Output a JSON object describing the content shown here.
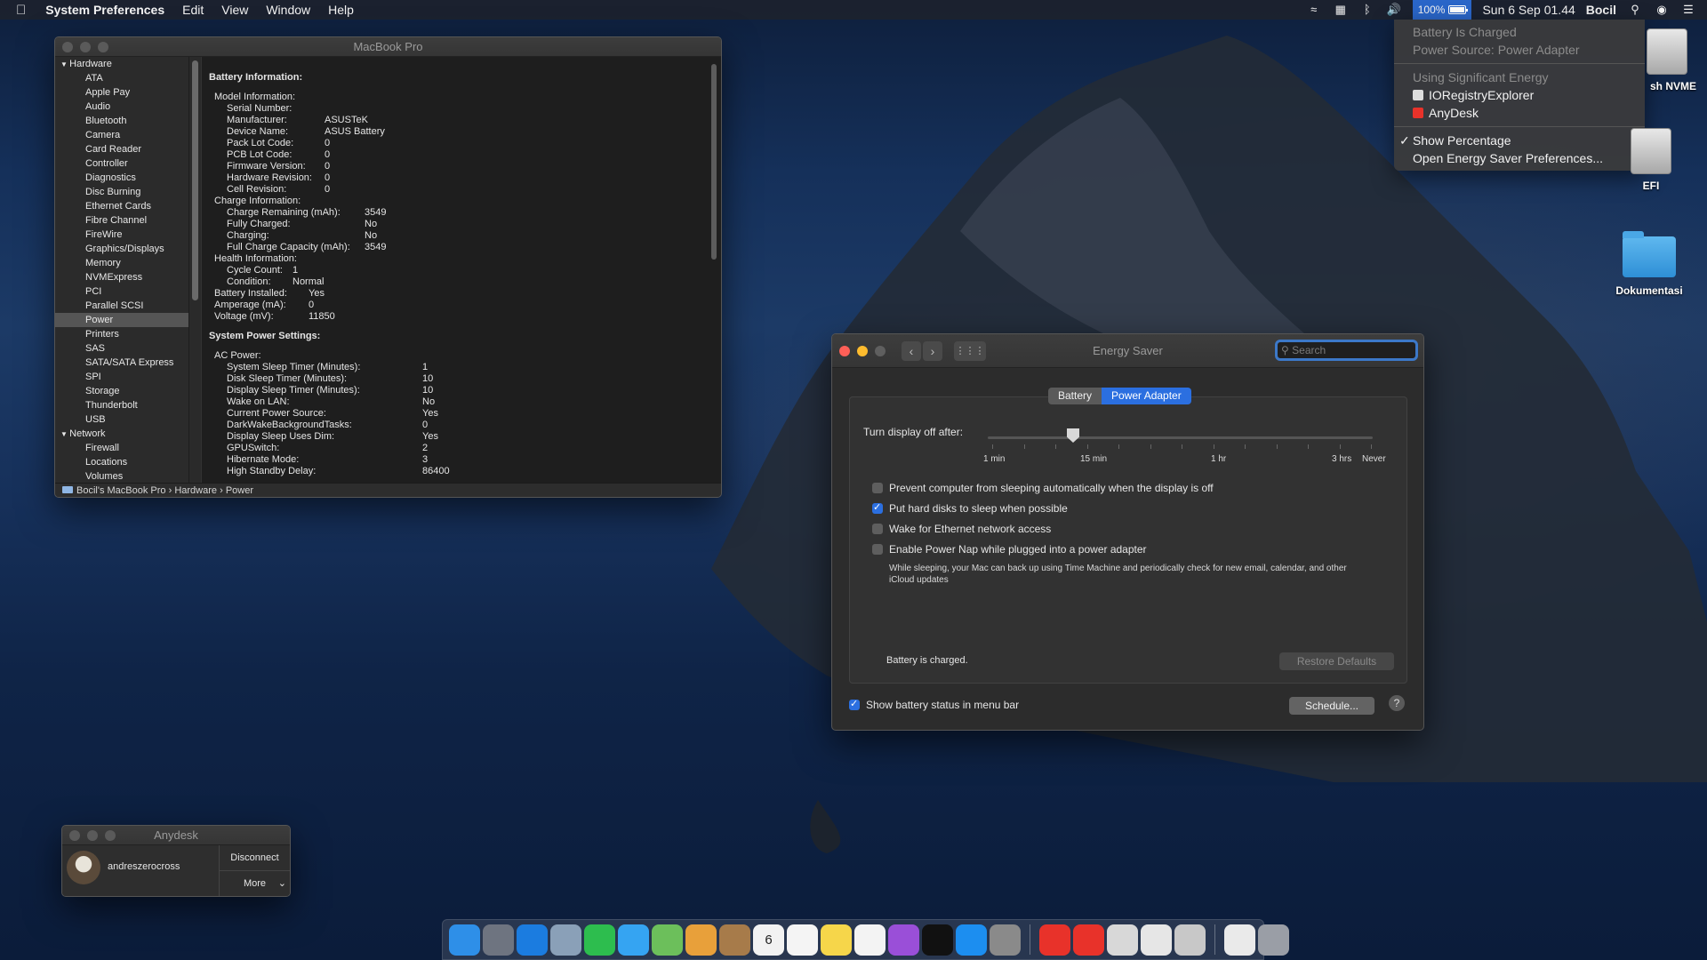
{
  "menubar": {
    "app_name": "System Preferences",
    "menus": [
      "Edit",
      "View",
      "Window",
      "Help"
    ],
    "battery_percent": "100%",
    "battery_level": 1.0,
    "datetime": "Sun 6 Sep  01.44",
    "user": "Bocil"
  },
  "battery_menu": {
    "status": "Battery Is Charged",
    "power_source": "Power Source: Power Adapter",
    "heading_energy": "Using Significant Energy",
    "apps": [
      "IORegistryExplorer",
      "AnyDesk"
    ],
    "show_percentage": "Show Percentage",
    "open_prefs": "Open Energy Saver Preferences..."
  },
  "desktop": {
    "icons": [
      "sh NVME",
      "EFI",
      "Dokumentasi"
    ]
  },
  "sysinfo": {
    "title": "MacBook Pro",
    "sidebar": [
      {
        "label": "Hardware",
        "group": true
      },
      {
        "label": "ATA"
      },
      {
        "label": "Apple Pay"
      },
      {
        "label": "Audio"
      },
      {
        "label": "Bluetooth"
      },
      {
        "label": "Camera"
      },
      {
        "label": "Card Reader"
      },
      {
        "label": "Controller"
      },
      {
        "label": "Diagnostics"
      },
      {
        "label": "Disc Burning"
      },
      {
        "label": "Ethernet Cards"
      },
      {
        "label": "Fibre Channel"
      },
      {
        "label": "FireWire"
      },
      {
        "label": "Graphics/Displays"
      },
      {
        "label": "Memory"
      },
      {
        "label": "NVMExpress"
      },
      {
        "label": "PCI"
      },
      {
        "label": "Parallel SCSI"
      },
      {
        "label": "Power",
        "selected": true
      },
      {
        "label": "Printers"
      },
      {
        "label": "SAS"
      },
      {
        "label": "SATA/SATA Express"
      },
      {
        "label": "SPI"
      },
      {
        "label": "Storage"
      },
      {
        "label": "Thunderbolt"
      },
      {
        "label": "USB"
      },
      {
        "label": "Network",
        "group": true
      },
      {
        "label": "Firewall"
      },
      {
        "label": "Locations"
      },
      {
        "label": "Volumes"
      }
    ],
    "content": [
      {
        "t": "Battery Information:",
        "h": true,
        "i": 0,
        "gap": 1
      },
      {
        "t": "Model Information:",
        "i": 1,
        "gap": 1
      },
      {
        "t": "Serial Number:",
        "v": "",
        "i": 2
      },
      {
        "t": "Manufacturer:",
        "v": "ASUSTeK",
        "i": 2
      },
      {
        "t": "Device Name:",
        "v": "ASUS Battery",
        "i": 2
      },
      {
        "t": "Pack Lot Code:",
        "v": "0",
        "i": 2
      },
      {
        "t": "PCB Lot Code:",
        "v": "0",
        "i": 2
      },
      {
        "t": "Firmware Version:",
        "v": "0",
        "i": 2
      },
      {
        "t": "Hardware Revision:",
        "v": "0",
        "i": 2
      },
      {
        "t": "Cell Revision:",
        "v": "0",
        "i": 2
      },
      {
        "t": "Charge Information:",
        "i": 1
      },
      {
        "t": "Charge Remaining (mAh):",
        "v": "3549",
        "i": 2,
        "vc": 2
      },
      {
        "t": "Fully Charged:",
        "v": "No",
        "i": 2,
        "vc": 2
      },
      {
        "t": "Charging:",
        "v": "No",
        "i": 2,
        "vc": 2
      },
      {
        "t": "Full Charge Capacity (mAh):",
        "v": "3549",
        "i": 2,
        "vc": 2
      },
      {
        "t": "Health Information:",
        "i": 1
      },
      {
        "t": "Cycle Count:",
        "v": "1",
        "i": 2,
        "vc": 3
      },
      {
        "t": "Condition:",
        "v": "Normal",
        "i": 2,
        "vc": 4
      },
      {
        "t": "Battery Installed:",
        "v": "Yes",
        "i": 1,
        "vc": 5
      },
      {
        "t": "Amperage (mA):",
        "v": "0",
        "i": 1,
        "vc": 5
      },
      {
        "t": "Voltage (mV):",
        "v": "11850",
        "i": 1,
        "vc": 5
      },
      {
        "t": "System Power Settings:",
        "h": true,
        "i": 0,
        "gap": 1
      },
      {
        "t": "AC Power:",
        "i": 1,
        "gap": 1
      },
      {
        "t": "System Sleep Timer (Minutes):",
        "v": "1",
        "i": 2,
        "vc": 6
      },
      {
        "t": "Disk Sleep Timer (Minutes):",
        "v": "10",
        "i": 2,
        "vc": 6
      },
      {
        "t": "Display Sleep Timer (Minutes):",
        "v": "10",
        "i": 2,
        "vc": 6
      },
      {
        "t": "Wake on LAN:",
        "v": "No",
        "i": 2,
        "vc": 6
      },
      {
        "t": "Current Power Source:",
        "v": "Yes",
        "i": 2,
        "vc": 6
      },
      {
        "t": "DarkWakeBackgroundTasks:",
        "v": "0",
        "i": 2,
        "vc": 6
      },
      {
        "t": "Display Sleep Uses Dim:",
        "v": "Yes",
        "i": 2,
        "vc": 6
      },
      {
        "t": "GPUSwitch:",
        "v": "2",
        "i": 2,
        "vc": 6
      },
      {
        "t": "Hibernate Mode:",
        "v": "3",
        "i": 2,
        "vc": 6
      },
      {
        "t": "High Standby Delay:",
        "v": "86400",
        "i": 2,
        "vc": 6
      }
    ],
    "path": [
      "Bocil's MacBook Pro",
      "Hardware",
      "Power"
    ]
  },
  "energy": {
    "title": "Energy Saver",
    "search_placeholder": "Search",
    "tabs": [
      "Battery",
      "Power Adapter"
    ],
    "active_tab": "Power Adapter",
    "slider_label": "Turn display off after:",
    "slider_value": "10 min",
    "tick_labels": [
      "1 min",
      "15 min",
      "1 hr",
      "3 hrs",
      "Never"
    ],
    "options": [
      {
        "label": "Prevent computer from sleeping automatically when the display is off",
        "checked": false
      },
      {
        "label": "Put hard disks to sleep when possible",
        "checked": true
      },
      {
        "label": "Wake for Ethernet network access",
        "checked": false
      },
      {
        "label": "Enable Power Nap while plugged into a power adapter",
        "checked": false
      }
    ],
    "power_nap_desc": "While sleeping, your Mac can back up using Time Machine and periodically check for new email, calendar, and other iCloud updates",
    "battery_status": "Battery is charged.",
    "restore_defaults": "Restore Defaults",
    "show_status_label": "Show battery status in menu bar",
    "show_status_checked": true,
    "schedule": "Schedule...",
    "help": "?"
  },
  "anydesk": {
    "title": "Anydesk",
    "user": "andreszerocross",
    "disconnect": "Disconnect",
    "more": "More"
  },
  "dock": {
    "calendar_day": "6",
    "items": [
      {
        "name": "finder-icon",
        "color": "#2e8fe8"
      },
      {
        "name": "launchpad-icon",
        "color": "#6e7480"
      },
      {
        "name": "safari-icon",
        "color": "#1b7ce0"
      },
      {
        "name": "preview-icon",
        "color": "#8aa0b8"
      },
      {
        "name": "facetime-icon",
        "color": "#2dbd4e"
      },
      {
        "name": "messages-icon",
        "color": "#35a4f2"
      },
      {
        "name": "maps-icon",
        "color": "#6cbf5b"
      },
      {
        "name": "photos-icon",
        "color": "#e8a03a"
      },
      {
        "name": "contacts-icon",
        "color": "#a77b4a"
      },
      {
        "name": "calendar-icon",
        "color": "#f2f2f2"
      },
      {
        "name": "reminders-icon",
        "color": "#f4f4f4"
      },
      {
        "name": "notes-icon",
        "color": "#f6d64a"
      },
      {
        "name": "music-icon",
        "color": "#f3f3f3"
      },
      {
        "name": "podcasts-icon",
        "color": "#9a4fd8"
      },
      {
        "name": "tv-icon",
        "color": "#111111"
      },
      {
        "name": "app-store-icon",
        "color": "#1c8ef0"
      },
      {
        "name": "system-preferences-icon",
        "color": "#8a8a8a"
      },
      {
        "name": "anydesk-icon",
        "color": "#e8322a"
      },
      {
        "name": "anydesk-alt-icon",
        "color": "#e8322a"
      },
      {
        "name": "script-editor-icon",
        "color": "#d8d8d8"
      },
      {
        "name": "textedit-icon",
        "color": "#e6e6e6"
      },
      {
        "name": "ioregistry-icon",
        "color": "#c8c8c8"
      },
      {
        "name": "document-icon",
        "color": "#eaeaea"
      },
      {
        "name": "trash-icon",
        "color": "#9a9ea6"
      }
    ]
  }
}
